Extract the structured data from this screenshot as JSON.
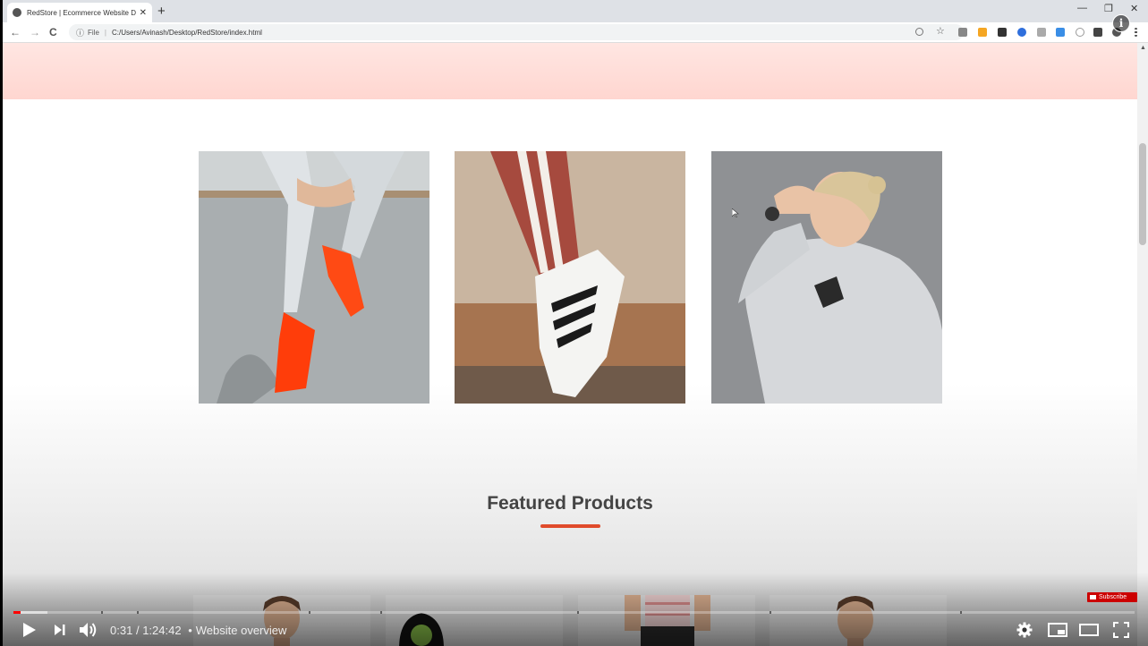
{
  "browser": {
    "tab_title": "RedStore | Ecommerce Website D",
    "tab_close": "✕",
    "new_tab": "+",
    "window_controls": [
      "—",
      "❐",
      "✕"
    ],
    "nav": [
      "←",
      "→",
      "C"
    ],
    "address": {
      "info_icon": "ⓘ",
      "scheme_label": "File",
      "separator": "|",
      "url": "C:/Users/Avinash/Desktop/RedStore/index.html"
    },
    "extension_icons": [
      "zoom-icon",
      "star-icon",
      "camera-icon",
      "bell-icon",
      "m-icon",
      "blue-circle-icon",
      "link-icon",
      "iq-icon",
      "grammarly-icon",
      "puzzle-icon",
      "profile-icon",
      "menu-icon"
    ]
  },
  "page": {
    "categories": [
      {
        "name": "category-jeans-sneakers"
      },
      {
        "name": "category-striped-sneaker"
      },
      {
        "name": "category-hoodie-woman"
      }
    ],
    "featured_title": "Featured Products",
    "accent": "#e04b2b"
  },
  "player": {
    "info_icon": "i",
    "subscribe_label": "Subscribe",
    "current_time": "0:31",
    "duration": "1:24:42",
    "time_separator": "/",
    "bullet": "•",
    "chapter_title": "Website overview",
    "played_fraction": 0.006,
    "buffered_fraction": 0.03
  }
}
